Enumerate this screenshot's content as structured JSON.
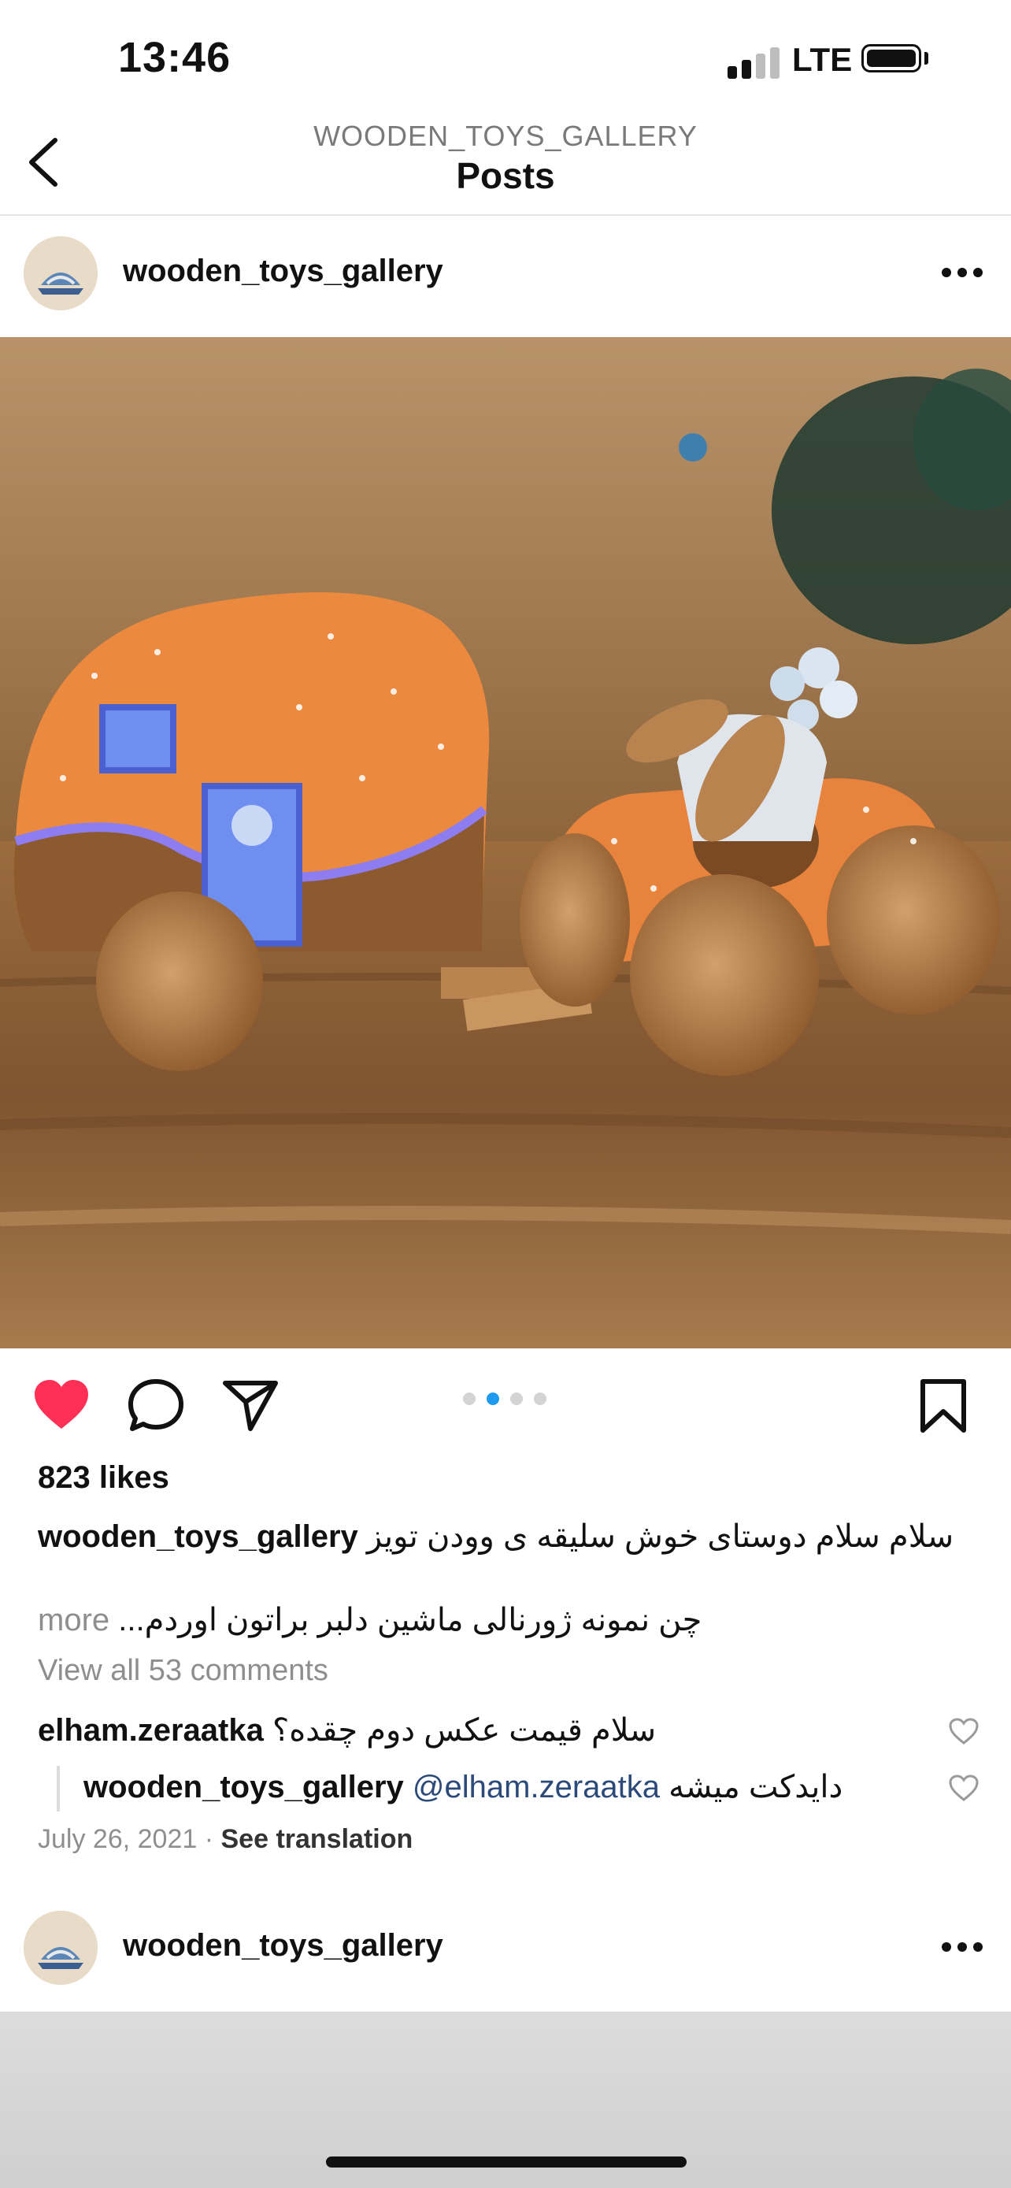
{
  "status_bar": {
    "time": "13:46",
    "network": "LTE"
  },
  "nav": {
    "subtitle": "WOODEN_TOYS_GALLERY",
    "title": "Posts"
  },
  "post": {
    "username": "wooden_toys_gallery",
    "image_carousel": {
      "count": 4,
      "active_index": 1
    },
    "liked": true,
    "likes": "823 likes",
    "caption_user": "wooden_toys_gallery",
    "caption_line1": "سلام سلام دوستای خوش سلیقه ی وودن تویز",
    "caption_line2": "چن نمونه ژورنالی ماشین دلبر براتون اوردم...",
    "caption_more": "more",
    "view_all_comments": "View all 53 comments",
    "comments": [
      {
        "user": "elham.zeraatka",
        "text": "سلام قیمت عکس دوم چقده؟"
      },
      {
        "user": "wooden_toys_gallery",
        "mention": "@elham.zeraatka",
        "text": "دایدکت میشه"
      }
    ],
    "date": "July 26, 2021",
    "see_translation": "See translation"
  },
  "next_post": {
    "username": "wooden_toys_gallery"
  },
  "colors": {
    "like_red": "#ff2f55",
    "carousel_active": "#1d9bf0",
    "muted": "#8e8e8e"
  },
  "icons": [
    "back-chevron-icon",
    "more-icon",
    "heart-icon",
    "comment-icon",
    "share-icon",
    "bookmark-icon"
  ]
}
